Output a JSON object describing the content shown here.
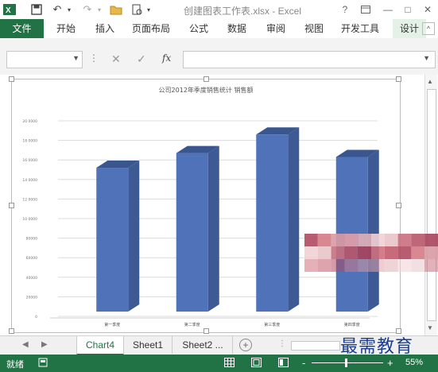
{
  "titlebar": {
    "title": "创建图表工作表.xlsx - Excel",
    "help": "?",
    "minimize": "—",
    "restore": "□",
    "close": "✕"
  },
  "ribbon": {
    "file": "文件",
    "tabs": [
      "开始",
      "插入",
      "页面布局",
      "公式",
      "数据",
      "审阅",
      "视图",
      "开发工具",
      "设计"
    ]
  },
  "formula_bar": {
    "fx": "fx",
    "name_box": "",
    "formula": ""
  },
  "chart_data": {
    "type": "bar",
    "title": "公司2012年季度销售统计  销售额",
    "categories": [
      "第一季度",
      "第二季度",
      "第三季度",
      "第四季度"
    ],
    "values": [
      15200,
      16700,
      18600,
      16300
    ],
    "yticks": [
      "0",
      "20000",
      "40000",
      "60000",
      "80000",
      "10 0000",
      "12 0000",
      "14 0000",
      "16 0000",
      "18 0000",
      "20 0000"
    ],
    "ylim": [
      0,
      20000
    ],
    "bar_color": "#4f72b8",
    "grid": true
  },
  "sheet_tabs": {
    "tabs": [
      "Chart4",
      "Sheet1",
      "Sheet2 ..."
    ],
    "add": "+"
  },
  "statusbar": {
    "ready": "就绪",
    "zoom": "55%",
    "zoom_minus": "-",
    "zoom_plus": "+"
  },
  "watermark": "最需教育"
}
